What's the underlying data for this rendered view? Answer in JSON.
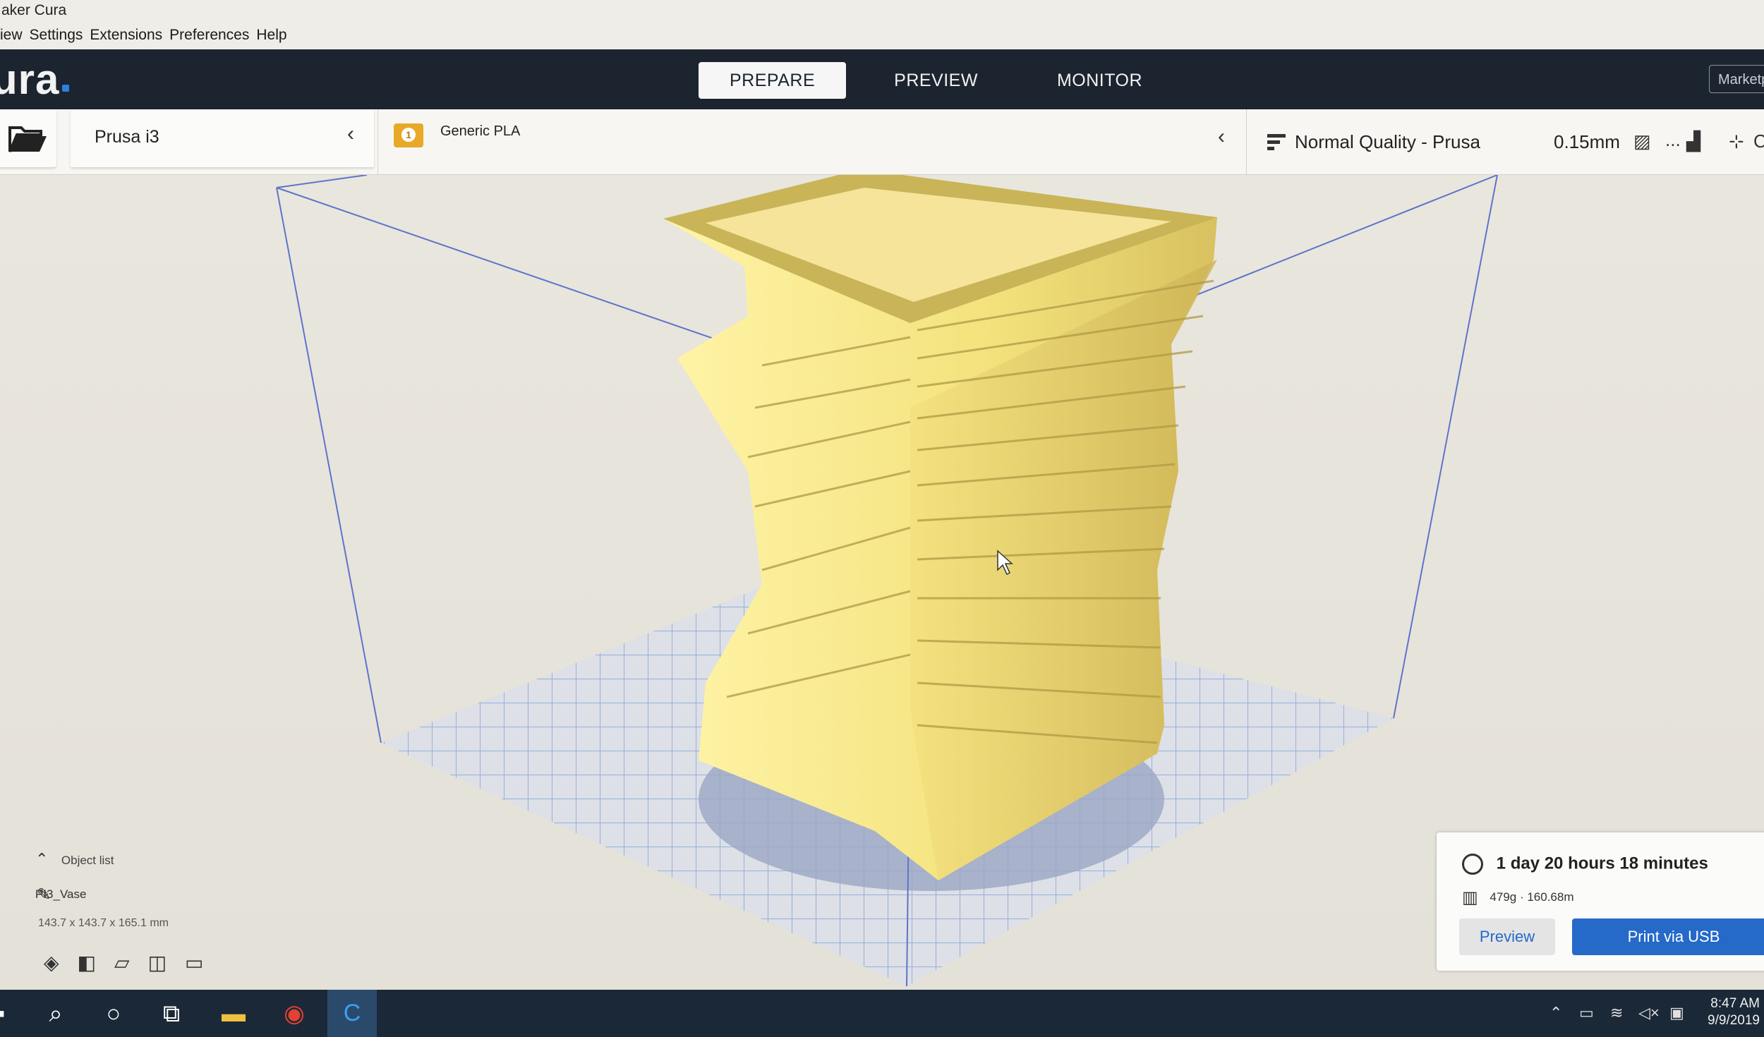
{
  "window": {
    "title": "aker Cura"
  },
  "menu": [
    {
      "label": "iew"
    },
    {
      "label": "Settings"
    },
    {
      "label": "Extensions"
    },
    {
      "label": "Preferences"
    },
    {
      "label": "Help"
    }
  ],
  "header": {
    "logo_text": "ura",
    "tabs": [
      {
        "label": "PREPARE",
        "active": true
      },
      {
        "label": "PREVIEW",
        "active": false
      },
      {
        "label": "MONITOR",
        "active": false
      }
    ],
    "marketplace_label": "Marketp"
  },
  "toolbar": {
    "open_icon": "folder-icon",
    "printer_label": "Prusa i3",
    "material_count": "1",
    "material_label": "Generic PLA",
    "quality_label": "Normal Quality - Prusa",
    "layer_height": "0.15mm",
    "support_cut": "...",
    "trailing_text": "C"
  },
  "object_list": {
    "header": "Object list",
    "object_name": "PI3_Vase",
    "dimensions": "143.7 x 143.7 x 165.1 mm"
  },
  "print_panel": {
    "time": "1 day 20 hours 18 minutes",
    "material": "479g · 160.68m",
    "preview_label": "Preview",
    "print_label": "Print via USB",
    "accent_color": "#2569c9"
  },
  "taskbar": {
    "time": "8:47 AM",
    "date": "9/9/2019"
  },
  "colors": {
    "header_bg": "#1c2430",
    "model_yellow": "#f1e07a",
    "grid_blue": "#7f9fd8"
  }
}
